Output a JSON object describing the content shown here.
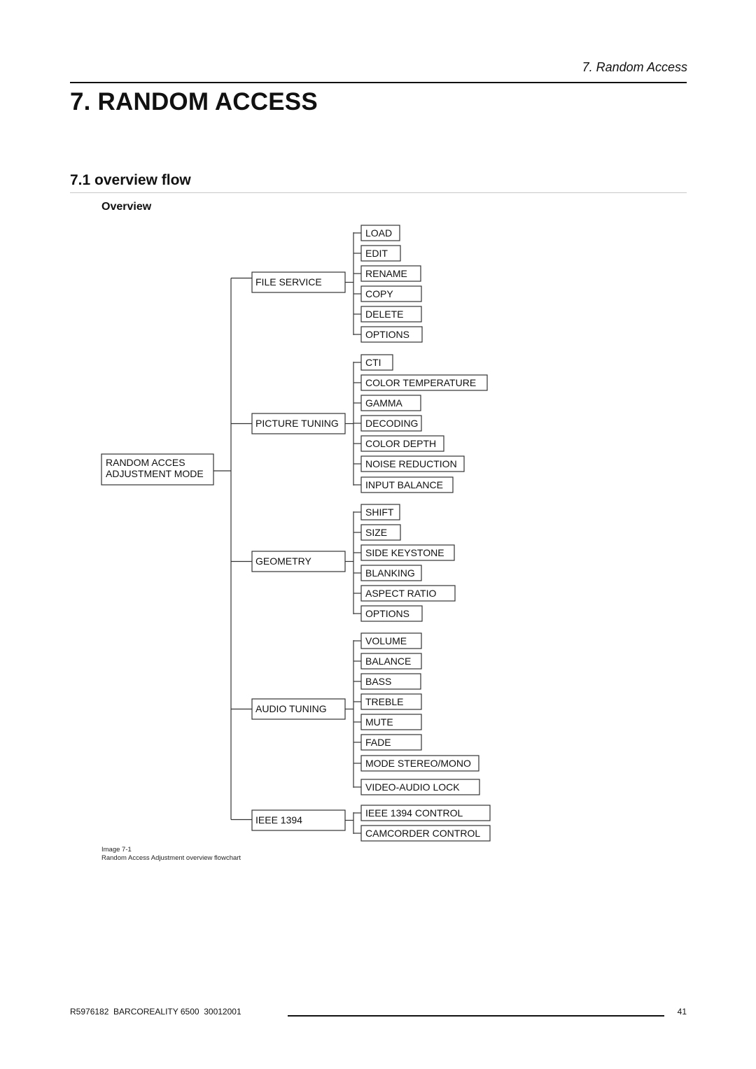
{
  "header": {
    "running_title": "7.  Random Access"
  },
  "chapter": {
    "title": "7.  RANDOM ACCESS"
  },
  "section": {
    "title": "7.1 overview flow",
    "subtitle": "Overview"
  },
  "flowchart": {
    "root": [
      "RANDOM ACCES",
      "ADJUSTMENT MODE"
    ],
    "groups": [
      {
        "label": "FILE SERVICE",
        "children": [
          "LOAD",
          "EDIT",
          "RENAME",
          "COPY",
          "DELETE",
          "OPTIONS"
        ]
      },
      {
        "label": "PICTURE TUNING",
        "children": [
          "CTI",
          "COLOR TEMPERATURE",
          "GAMMA",
          "DECODING",
          "COLOR DEPTH",
          "NOISE REDUCTION",
          "INPUT BALANCE"
        ]
      },
      {
        "label": "GEOMETRY",
        "children": [
          "SHIFT",
          "SIZE",
          "SIDE KEYSTONE",
          "BLANKING",
          "ASPECT RATIO",
          "OPTIONS"
        ]
      },
      {
        "label": "AUDIO TUNING",
        "children": [
          "VOLUME",
          "BALANCE",
          "BASS",
          "TREBLE",
          "MUTE",
          "FADE",
          "MODE STEREO/MONO",
          "VIDEO-AUDIO LOCK"
        ]
      },
      {
        "label": "IEEE 1394",
        "children": [
          "IEEE 1394 CONTROL",
          "CAMCORDER CONTROL"
        ]
      }
    ]
  },
  "caption": {
    "label": "Image 7-1",
    "text": "Random Access Adjustment overview flowchart"
  },
  "footer": {
    "doc_id": "R5976182  BARCOREALITY 6500  30012001",
    "page_number": "41"
  }
}
